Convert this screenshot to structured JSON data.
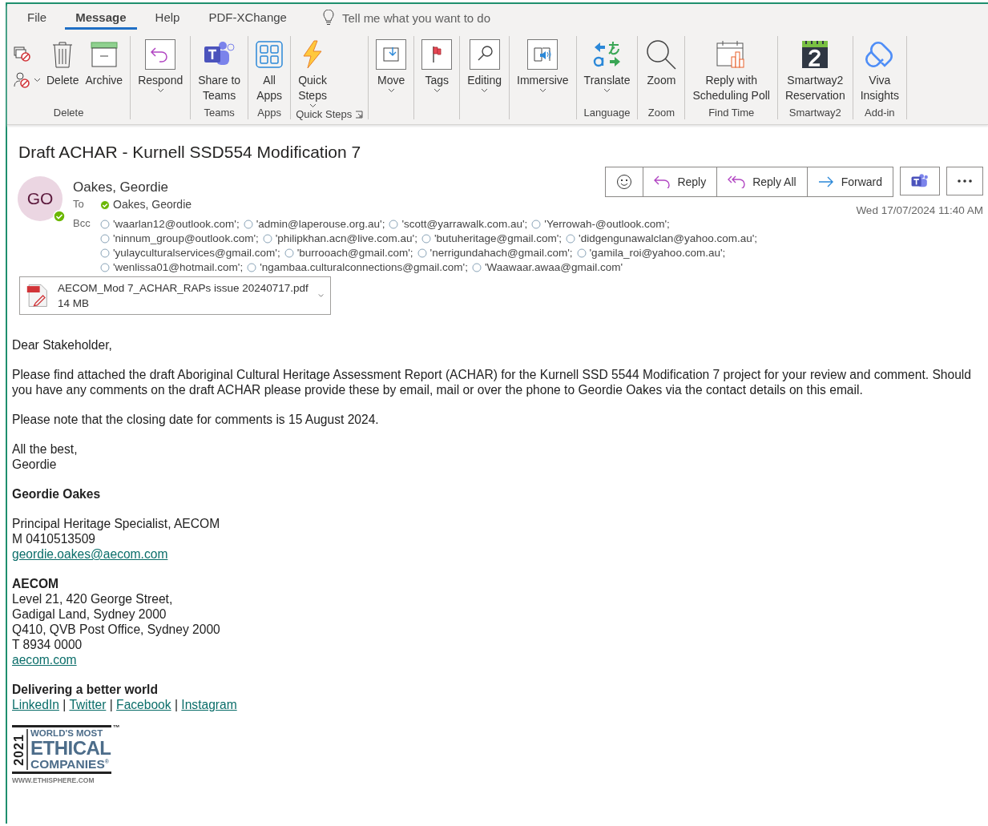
{
  "tabs": [
    {
      "label": "File",
      "selected": false
    },
    {
      "label": "Message",
      "selected": true
    },
    {
      "label": "Help",
      "selected": false
    },
    {
      "label": "PDF-XChange",
      "selected": false
    }
  ],
  "tell_me": {
    "text": "Tell me what you want to do"
  },
  "ribbon_groups": [
    {
      "label": "Delete",
      "buttons": [
        {
          "kind": "small",
          "dropdown": false
        },
        {
          "kind": "small",
          "dropdown": true
        },
        {
          "kind": "large",
          "label": "Delete",
          "dropdown": false
        },
        {
          "kind": "large",
          "label": "Archive",
          "dropdown": false
        }
      ]
    },
    {
      "buttons": [
        {
          "kind": "large",
          "label": "Respond",
          "dropdown": true
        }
      ]
    },
    {
      "label": "Teams",
      "buttons": [
        {
          "kind": "large",
          "label": "Share to\nTeams",
          "dropdown": false
        }
      ]
    },
    {
      "label": "Apps",
      "buttons": [
        {
          "kind": "large",
          "label": "All\nApps",
          "dropdown": false
        }
      ]
    },
    {
      "label": "Quick Steps",
      "launcher": true,
      "buttons": [
        {
          "kind": "large",
          "label": "Quick\nSteps",
          "dropdown": true
        }
      ]
    },
    {
      "buttons": [
        {
          "kind": "large",
          "label": "Move",
          "dropdown": true
        }
      ]
    },
    {
      "buttons": [
        {
          "kind": "large",
          "label": "Tags",
          "dropdown": true
        }
      ]
    },
    {
      "buttons": [
        {
          "kind": "large",
          "label": "Editing",
          "dropdown": true
        }
      ]
    },
    {
      "buttons": [
        {
          "kind": "large",
          "label": "Immersive",
          "dropdown": true
        }
      ]
    },
    {
      "label": "Language",
      "buttons": [
        {
          "kind": "large",
          "label": "Translate",
          "dropdown": true
        }
      ]
    },
    {
      "label": "Zoom",
      "buttons": [
        {
          "kind": "large",
          "label": "Zoom",
          "dropdown": false
        }
      ]
    },
    {
      "label": "Find Time",
      "buttons": [
        {
          "kind": "large",
          "label": "Reply with\nScheduling Poll",
          "dropdown": false
        }
      ]
    },
    {
      "label": "Smartway2",
      "buttons": [
        {
          "kind": "large",
          "label": "Smartway2\nReservation",
          "dropdown": false
        }
      ]
    },
    {
      "label": "Add-in",
      "buttons": [
        {
          "kind": "large",
          "label": "Viva\nInsights",
          "dropdown": false
        }
      ]
    }
  ],
  "subject": "Draft ACHAR -  Kurnell SSD554 Modification 7",
  "sender": {
    "initials": "GO",
    "name": "Oakes, Geordie",
    "online": true
  },
  "to": {
    "label": "To",
    "recipients": [
      {
        "name": "Oakes, Geordie",
        "online": true
      }
    ]
  },
  "bcc": {
    "label": "Bcc",
    "recipients": [
      {
        "name": "'waarlan12@outlook.com';",
        "online": false
      },
      {
        "name": "'admin@laperouse.org.au';",
        "online": false
      },
      {
        "name": "'scott@yarrawalk.com.au';",
        "online": false
      },
      {
        "name": "'Yerrowah-@outlook.com';",
        "online": false
      },
      {
        "name": "'ninnum_group@outlook.com';",
        "online": false
      },
      {
        "name": "'philipkhan.acn@live.com.au';",
        "online": false
      },
      {
        "name": "'butuheritage@gmail.com';",
        "online": false
      },
      {
        "name": "'didgengunawalclan@yahoo.com.au';",
        "online": false
      },
      {
        "name": "'yulayculturalservices@gmail.com';",
        "online": false
      },
      {
        "name": "'burrooach@gmail.com';",
        "online": false
      },
      {
        "name": "'nerrigundahach@gmail.com';",
        "online": false
      },
      {
        "name": "'gamila_roi@yahoo.com.au';",
        "online": false
      },
      {
        "name": "'wenlissa01@hotmail.com';",
        "online": false
      },
      {
        "name": "'ngambaa.culturalconnections@gmail.com';",
        "online": false
      },
      {
        "name": "'Waawaar.awaa@gmail.com'",
        "online": false
      }
    ]
  },
  "actions": [
    {
      "kind": "emoji"
    },
    {
      "kind": "reply",
      "label": "Reply"
    },
    {
      "kind": "reply_all",
      "label": "Reply All"
    },
    {
      "kind": "forward",
      "label": "Forward"
    },
    {
      "kind": "teams"
    },
    {
      "kind": "more"
    }
  ],
  "date": "Wed 17/07/2024 11:40 AM",
  "attachment": {
    "name": "AECOM_Mod 7_ACHAR_RAPs issue 20240717.pdf",
    "size": "14 MB"
  },
  "body": [
    {
      "lines": [
        {
          "kind": "text",
          "text": "Dear Stakeholder,"
        }
      ]
    },
    {
      "lines": [
        {
          "kind": "text",
          "text": "Please find attached the draft Aboriginal Cultural Heritage Assessment Report (ACHAR) for the Kurnell SSD 5544 Modification 7 project for your review and comment. Should you have any comments on the draft ACHAR please provide these by email, mail or over the phone to Geordie Oakes via the contact details on this email."
        }
      ]
    },
    {
      "lines": [
        {
          "kind": "text",
          "text": "Please note that the closing date for comments is 15 August 2024."
        }
      ]
    },
    {
      "lines": [
        {
          "kind": "text",
          "text": "All the best,"
        },
        {
          "kind": "text",
          "text": "Geordie"
        }
      ]
    },
    {
      "lines": [
        {
          "kind": "bold",
          "text": "Geordie Oakes"
        }
      ]
    },
    {
      "lines": [
        {
          "kind": "text",
          "text": "Principal Heritage Specialist, AECOM"
        },
        {
          "kind": "text",
          "text": "M 0410513509"
        },
        {
          "kind": "link",
          "text": "geordie.oakes@aecom.com"
        }
      ]
    },
    {
      "lines": [
        {
          "kind": "bold",
          "text": "AECOM"
        },
        {
          "kind": "text",
          "text": "Level 21, 420 George Street,"
        },
        {
          "kind": "text",
          "text": "Gadigal Land, Sydney 2000"
        },
        {
          "kind": "text",
          "text": "Q410, QVB Post Office, Sydney 2000"
        },
        {
          "kind": "text",
          "text": "T 8934 0000"
        },
        {
          "kind": "link",
          "text": "aecom.com"
        }
      ]
    },
    {
      "lines": [
        {
          "kind": "bold",
          "text": "Delivering a better world"
        },
        {
          "kind": "links",
          "separator": "|",
          "links": [
            "LinkedIn",
            "Twitter",
            "Facebook",
            "Instagram"
          ]
        }
      ]
    }
  ],
  "logo": {
    "year": "2021",
    "line_1": "WORLD'S MOST",
    "line_2": "ETHICAL",
    "line_3": "COMPANIES",
    "mark": "®",
    "trademark": "™",
    "url": "WWW.ETHISPHERE.COM"
  }
}
